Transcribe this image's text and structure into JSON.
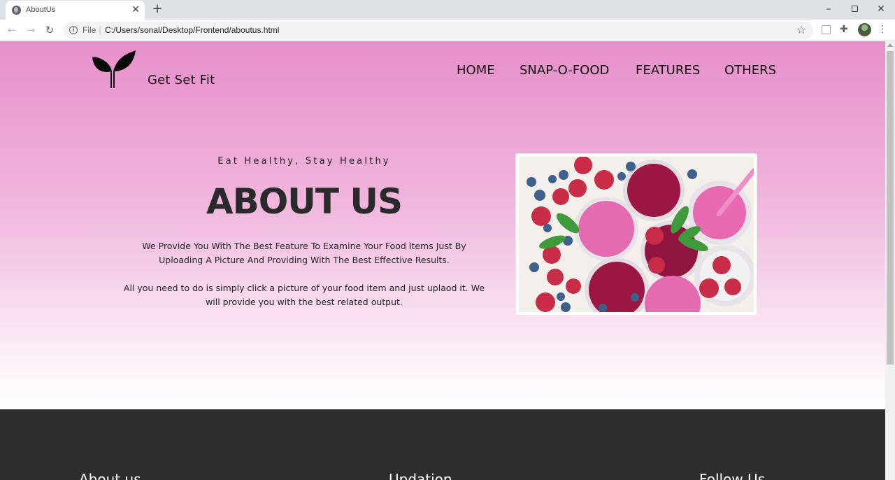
{
  "browser": {
    "tab_title": "AboutUs",
    "tab_close": "✕",
    "new_tab": "+",
    "file_label": "File",
    "url": "C:/Users/sonal/Desktop/Frontend/aboutus.html"
  },
  "header": {
    "brand": "Get Set Fit",
    "nav": [
      "HOME",
      "SNAP-O-FOOD",
      "FEATURES",
      "OTHERS"
    ]
  },
  "hero": {
    "tagline": "Eat Healthy, Stay Healthy",
    "title": "ABOUT US",
    "description_1": "We Provide You With The Best Feature To Examine Your Food Items Just By Uploading A Picture And Providing With The Best Effective Results.",
    "description_2": "All you need to do is simply click a picture of your food item and just uplaod it. We will provide you with the best related output."
  },
  "footer": {
    "headings": [
      "About us",
      "Updation",
      "Follow Us"
    ]
  },
  "colors": {
    "hero_top": "#e78fcb",
    "hero_bottom": "#ffffff",
    "footer_bg": "#2e2e2e"
  }
}
